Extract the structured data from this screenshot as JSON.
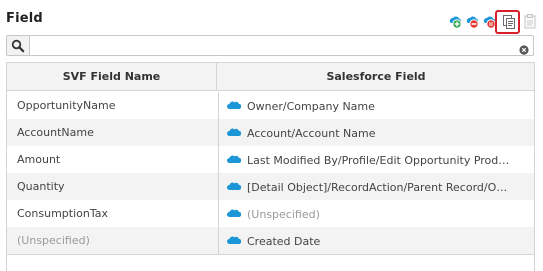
{
  "title": "Field",
  "toolbar": {
    "add_icon": "add-field-icon",
    "remove_icon": "remove-field-icon",
    "replace_icon": "replace-field-icon",
    "copy_icon": "copy-icon",
    "paste_icon": "paste-icon",
    "highlight_color": "#d9202a"
  },
  "search": {
    "value": "",
    "placeholder": ""
  },
  "grid": {
    "headers": [
      "SVF Field Name",
      "Salesforce Field"
    ],
    "rows": [
      {
        "svf": "OpportunityName",
        "sf": "Owner/Company Name",
        "svf_muted": false,
        "sf_muted": false
      },
      {
        "svf": "AccountName",
        "sf": "Account/Account Name",
        "svf_muted": false,
        "sf_muted": false
      },
      {
        "svf": "Amount",
        "sf": "Last Modified By/Profile/Edit Opportunity Prod…",
        "svf_muted": false,
        "sf_muted": false
      },
      {
        "svf": "Quantity",
        "sf": "[Detail Object]/RecordAction/Parent Record/O…",
        "svf_muted": false,
        "sf_muted": false
      },
      {
        "svf": "ConsumptionTax",
        "sf": "(Unspecified)",
        "svf_muted": false,
        "sf_muted": true
      },
      {
        "svf": "(Unspecified)",
        "sf": "Created Date",
        "svf_muted": true,
        "sf_muted": false
      }
    ]
  },
  "colors": {
    "salesforce_cloud": "#1b96d6",
    "add_badge": "#2fa84f",
    "remove_badge": "#e53935"
  }
}
